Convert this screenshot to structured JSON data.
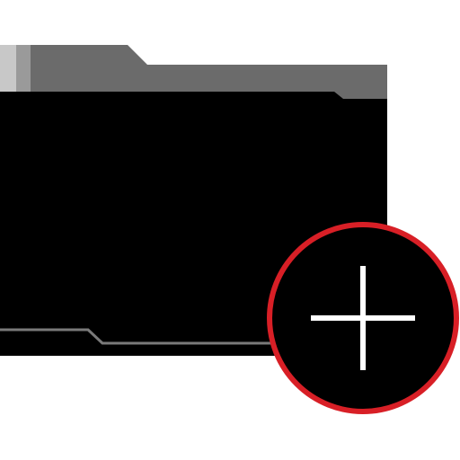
{
  "icon": {
    "name": "add-folder-icon",
    "parts": {
      "folder": "folder-icon",
      "badge": "plus-badge",
      "plus": "plus-icon"
    }
  },
  "colors": {
    "background": "#ffffff",
    "folder_tab": "#6b6b6b",
    "folder_tab_highlight_light": "#c8c8c8",
    "folder_tab_highlight_mid": "#9a9a9a",
    "folder_body": "#000000",
    "folder_accent_line": "#7a7a7a",
    "badge_fill": "#000000",
    "badge_ring": "#d81f26",
    "plus_stroke": "#ffffff"
  }
}
